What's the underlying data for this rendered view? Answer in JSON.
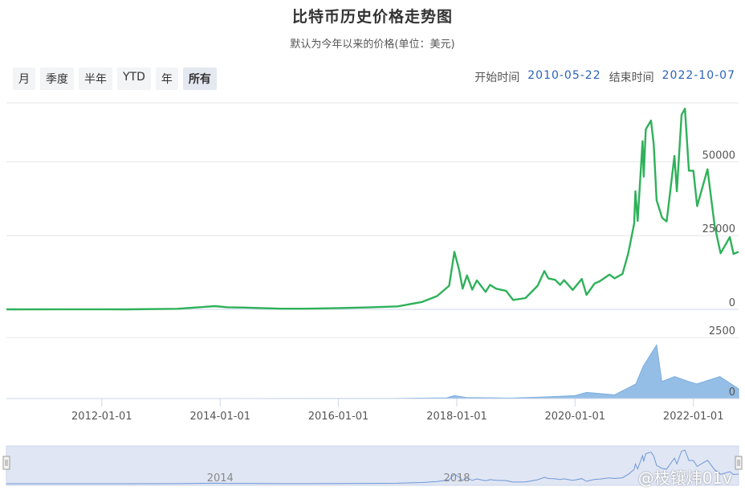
{
  "header": {
    "title": "比特币历史价格走势图",
    "subtitle": "默认为今年以来的价格(单位：美元)"
  },
  "range_buttons": [
    {
      "label": "月",
      "active": false
    },
    {
      "label": "季度",
      "active": false
    },
    {
      "label": "半年",
      "active": false
    },
    {
      "label": "YTD",
      "active": false
    },
    {
      "label": "年",
      "active": false
    },
    {
      "label": "所有",
      "active": true
    }
  ],
  "date_range": {
    "start_label": "开始时间",
    "start_value": "2010-05-22",
    "end_label": "结束时间",
    "end_value": "2022-10-07"
  },
  "watermark": "@枝镶炜01v",
  "colors": {
    "price_line": "#2fb15a",
    "volume": "#7aaee0",
    "navigator_bg": "#ccd6eb",
    "navigator_line": "#6f98d8"
  },
  "chart_data": {
    "type": "line",
    "x_range": [
      "2010-05-22",
      "2022-10-07"
    ],
    "price": {
      "ylim": [
        0,
        70000
      ],
      "yticks": [
        0,
        25000,
        50000
      ],
      "points": [
        [
          "2010-05-22",
          0
        ],
        [
          "2011-06-08",
          30
        ],
        [
          "2012-06-01",
          8
        ],
        [
          "2013-04-10",
          200
        ],
        [
          "2013-11-30",
          1100
        ],
        [
          "2014-02-15",
          700
        ],
        [
          "2014-06-01",
          600
        ],
        [
          "2015-01-15",
          210
        ],
        [
          "2015-06-01",
          230
        ],
        [
          "2016-01-01",
          430
        ],
        [
          "2016-07-01",
          650
        ],
        [
          "2017-01-01",
          1000
        ],
        [
          "2017-06-01",
          2500
        ],
        [
          "2017-09-01",
          4500
        ],
        [
          "2017-11-15",
          8000
        ],
        [
          "2017-12-17",
          19500
        ],
        [
          "2018-01-15",
          13500
        ],
        [
          "2018-02-06",
          7000
        ],
        [
          "2018-03-05",
          11500
        ],
        [
          "2018-04-06",
          6700
        ],
        [
          "2018-05-05",
          9800
        ],
        [
          "2018-06-28",
          5900
        ],
        [
          "2018-07-25",
          8300
        ],
        [
          "2018-09-01",
          7000
        ],
        [
          "2018-11-01",
          6300
        ],
        [
          "2018-12-15",
          3200
        ],
        [
          "2019-03-01",
          3800
        ],
        [
          "2019-05-15",
          8000
        ],
        [
          "2019-06-26",
          13000
        ],
        [
          "2019-07-20",
          10500
        ],
        [
          "2019-09-01",
          10000
        ],
        [
          "2019-10-01",
          8300
        ],
        [
          "2019-10-26",
          9900
        ],
        [
          "2019-12-18",
          6600
        ],
        [
          "2020-02-12",
          10300
        ],
        [
          "2020-03-12",
          4900
        ],
        [
          "2020-05-01",
          8800
        ],
        [
          "2020-06-01",
          9500
        ],
        [
          "2020-08-01",
          11800
        ],
        [
          "2020-09-01",
          10500
        ],
        [
          "2020-10-20",
          12000
        ],
        [
          "2020-11-25",
          19000
        ],
        [
          "2020-12-31",
          29000
        ],
        [
          "2021-01-08",
          40000
        ],
        [
          "2021-01-22",
          30000
        ],
        [
          "2021-02-21",
          57000
        ],
        [
          "2021-02-28",
          45000
        ],
        [
          "2021-03-13",
          61000
        ],
        [
          "2021-04-14",
          64000
        ],
        [
          "2021-05-01",
          56000
        ],
        [
          "2021-05-19",
          37000
        ],
        [
          "2021-06-22",
          31000
        ],
        [
          "2021-07-20",
          29800
        ],
        [
          "2021-09-06",
          52000
        ],
        [
          "2021-09-21",
          40000
        ],
        [
          "2021-10-20",
          66000
        ],
        [
          "2021-11-10",
          68000
        ],
        [
          "2021-12-04",
          47000
        ],
        [
          "2022-01-01",
          47000
        ],
        [
          "2022-01-24",
          35000
        ],
        [
          "2022-03-29",
          47500
        ],
        [
          "2022-05-12",
          28500
        ],
        [
          "2022-06-18",
          19000
        ],
        [
          "2022-08-14",
          24500
        ],
        [
          "2022-09-06",
          18800
        ],
        [
          "2022-10-07",
          19500
        ]
      ]
    },
    "volume": {
      "ylim": [
        0,
        3000
      ],
      "yticks": [
        0,
        2500
      ],
      "points": [
        [
          "2010-05-22",
          0
        ],
        [
          "2016-12-01",
          2
        ],
        [
          "2017-11-01",
          30
        ],
        [
          "2017-12-17",
          120
        ],
        [
          "2018-03-01",
          40
        ],
        [
          "2018-12-01",
          20
        ],
        [
          "2019-06-01",
          60
        ],
        [
          "2020-01-01",
          120
        ],
        [
          "2020-03-12",
          250
        ],
        [
          "2020-09-01",
          150
        ],
        [
          "2021-01-11",
          600
        ],
        [
          "2021-02-23",
          1300
        ],
        [
          "2021-05-19",
          2200
        ],
        [
          "2021-06-20",
          700
        ],
        [
          "2021-09-07",
          900
        ],
        [
          "2021-12-04",
          700
        ],
        [
          "2022-01-22",
          600
        ],
        [
          "2022-06-13",
          900
        ],
        [
          "2022-10-07",
          400
        ]
      ]
    },
    "x_ticks": [
      "2012-01-01",
      "2014-01-01",
      "2016-01-01",
      "2018-01-01",
      "2020-01-01",
      "2022-01-01"
    ],
    "navigator_ticks": [
      "2014",
      "2018"
    ]
  }
}
